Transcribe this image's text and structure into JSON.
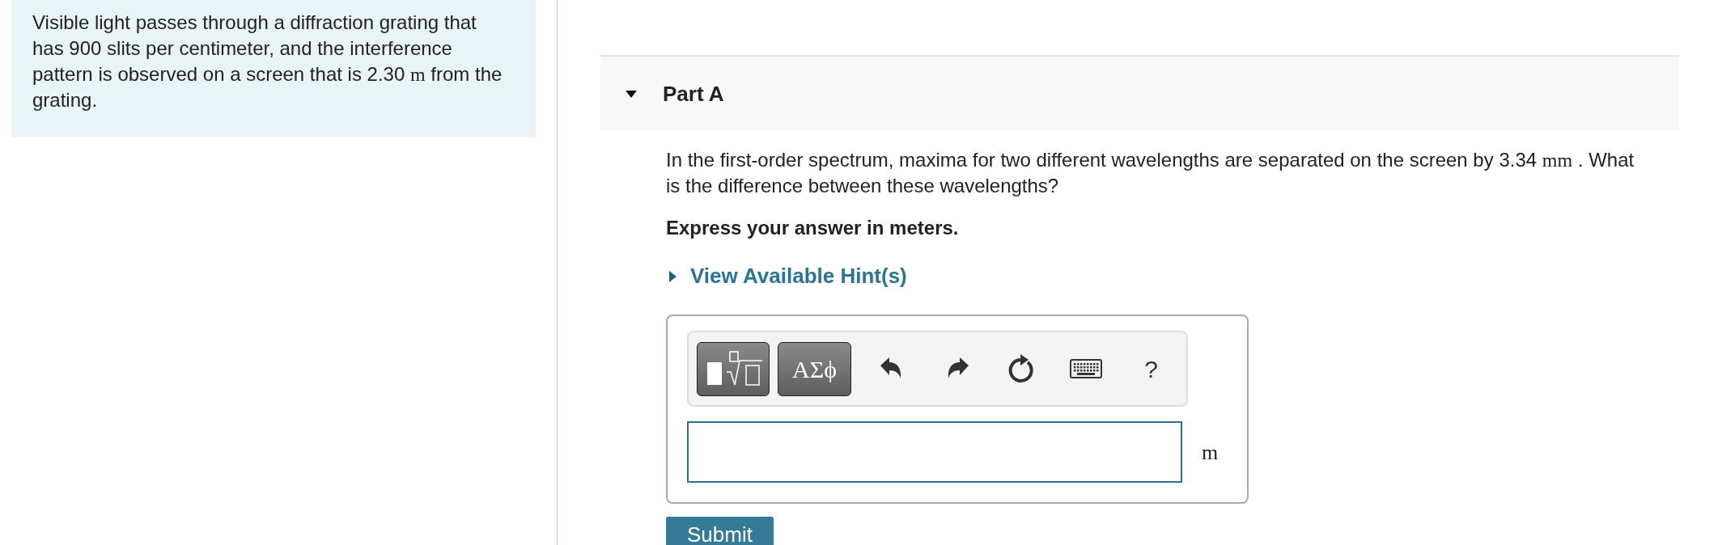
{
  "intro": {
    "text_before": "Visible light passes through a diffraction grating that has 900 slits per centimeter, and the interference pattern is observed on a screen that is 2.30",
    "unit": "m",
    "text_after": "from the grating."
  },
  "part": {
    "title": "Part A",
    "expanded": true,
    "question": {
      "text_before": "In the first-order spectrum, maxima for two different wavelengths are separated on the screen by 3.34",
      "unit": "mm",
      "text_after": ". What is the difference between these wavelengths?"
    },
    "instruction": "Express your answer in meters.",
    "hints": {
      "label": "View Available Hint(s)",
      "expanded": false
    },
    "toolbar": [
      {
        "kind": "templates"
      },
      {
        "kind": "greek",
        "label": "ΑΣϕ"
      },
      {
        "kind": "undo"
      },
      {
        "kind": "redo"
      },
      {
        "kind": "reset"
      },
      {
        "kind": "keyboard"
      },
      {
        "kind": "help",
        "label": "?"
      }
    ],
    "answer": {
      "unit": "m"
    },
    "submit": "Submit"
  }
}
